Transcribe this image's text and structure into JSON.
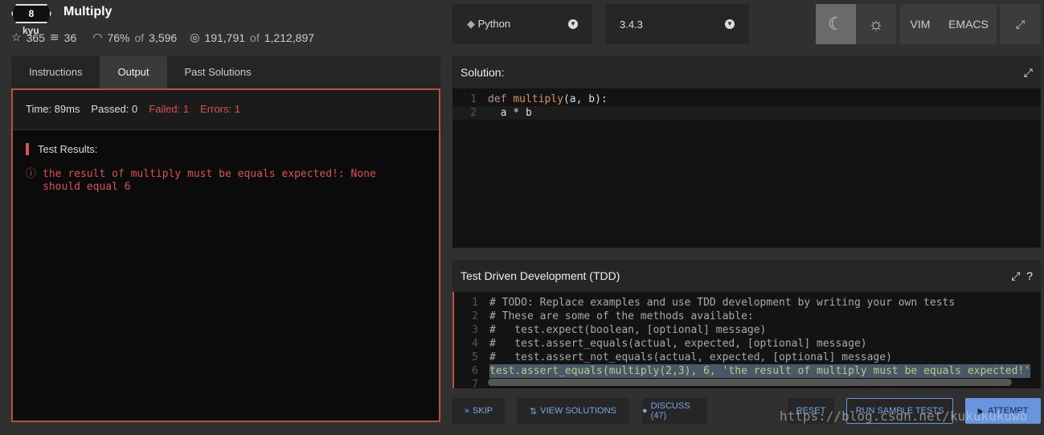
{
  "kata": {
    "rank": "8",
    "rank_unit": "kyu",
    "title": "Multiply",
    "stars": "365",
    "collections": "36",
    "satisfaction": "76%",
    "satisfaction_of": "of",
    "votes": "3,596",
    "completed": "191,791",
    "completed_of": "of",
    "attempted": "1,212,897"
  },
  "tabs": [
    {
      "label": "Instructions"
    },
    {
      "label": "Output"
    },
    {
      "label": "Past Solutions"
    }
  ],
  "output": {
    "time": "Time: 89ms",
    "passed": "Passed: 0",
    "failed": "Failed: 1",
    "errors": "Errors: 1",
    "results_title": "Test Results:",
    "error_message": "the result of multiply must be equals expected!: None should equal 6"
  },
  "toolbar": {
    "language": "Python",
    "version": "3.4.3",
    "vim": "VIM",
    "emacs": "EMACS"
  },
  "solution": {
    "title": "Solution:",
    "lines": [
      "def multiply(a, b):",
      "  a * b"
    ]
  },
  "tdd": {
    "title": "Test Driven Development (TDD)",
    "lines": [
      "# TODO: Replace examples and use TDD development by writing your own tests",
      "# These are some of the methods available:",
      "#   test.expect(boolean, [optional] message)",
      "#   test.assert_equals(actual, expected, [optional] message)",
      "#   test.assert_not_equals(actual, expected, [optional] message)",
      "test.assert_equals(multiply(2,3), 6, 'the result of multiply must be equals expected!'",
      ""
    ]
  },
  "buttons": {
    "skip": "SKIP",
    "view_solutions": "VIEW SOLUTIONS",
    "discuss": "DISCUSS (47)",
    "reset": "RESET",
    "run_sample": "RUN SAMPLE TESTS",
    "attempt": "ATTEMPT"
  },
  "watermark": "https://blog.csdn.net/kukukukuwo",
  "colors": {
    "error": "#d9534f",
    "accent": "#6795de"
  }
}
